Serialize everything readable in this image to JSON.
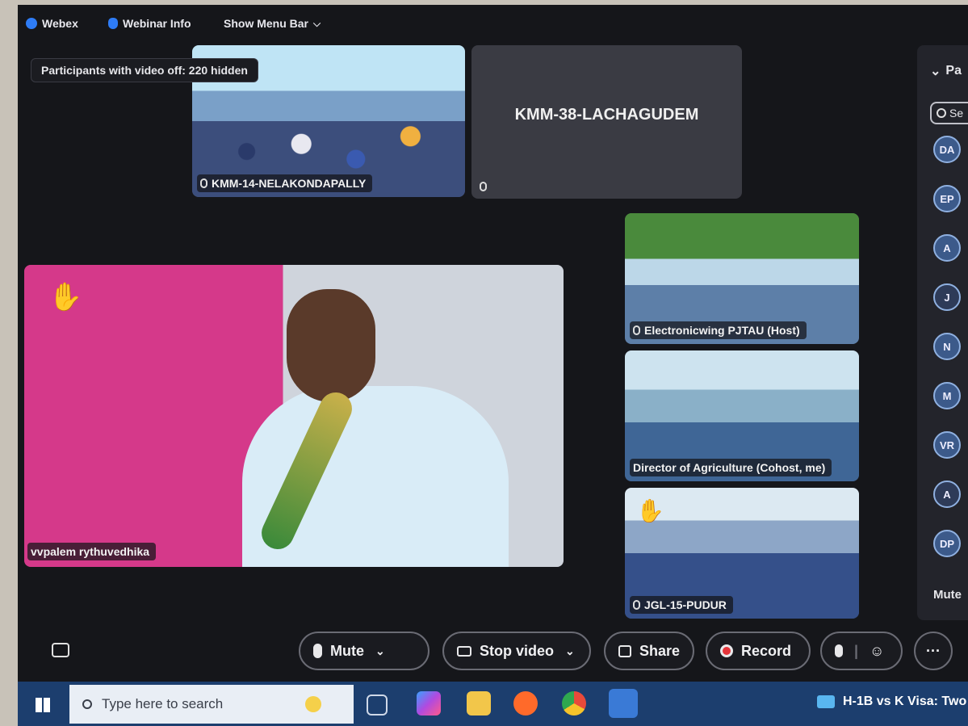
{
  "topbar": {
    "webex": "Webex",
    "webinar_info": "Webinar Info",
    "show_menu_bar": "Show Menu Bar"
  },
  "tooltip": "Participants with video off: 220 hidden",
  "tiles": {
    "t1": "KMM-14-NELAKONDAPALLY",
    "t2": "KMM-38-LACHAGUDEM",
    "t3": "Electronicwing PJTAU (Host)",
    "t4": "Director of Agriculture (Cohost, me)",
    "t5": "JGL-15-PUDUR",
    "main": "vvpalem rythuvedhika"
  },
  "sidebar": {
    "heading": "Pa",
    "search": "Se",
    "avatars": [
      "DA",
      "EP",
      "A",
      "J",
      "N",
      "M",
      "VR",
      "A",
      "DP"
    ],
    "mute": "Mute"
  },
  "controls": {
    "mute": "Mute",
    "stop_video": "Stop video",
    "share": "Share",
    "record": "Record",
    "more": "···"
  },
  "taskbar": {
    "search_placeholder": "Type here to search",
    "news": "H-1B vs K Visa: Two"
  },
  "colors": {
    "accent": "#2e7cf6",
    "record": "#e5343a",
    "taskbar": "#1c3e6e"
  }
}
